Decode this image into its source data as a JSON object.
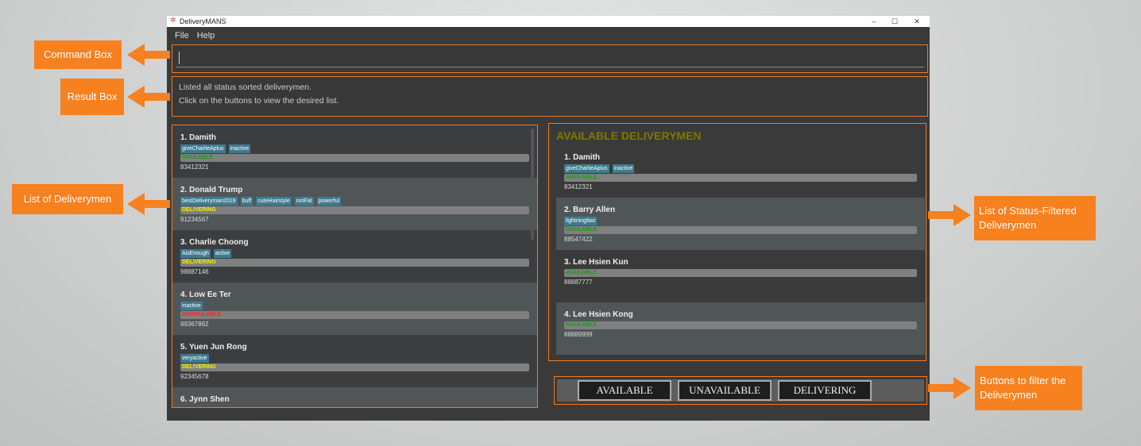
{
  "window": {
    "title": "DeliveryMANS",
    "controls": [
      "–",
      "☐",
      "✕"
    ]
  },
  "menu": [
    "File",
    "Help"
  ],
  "command_box": {
    "value": ""
  },
  "result_box": {
    "lines": [
      "Listed all status sorted deliverymen.",
      "Click on the buttons to view the desired list."
    ]
  },
  "status_colors": {
    "AVAILABLE": "#1a9a1a",
    "DELIVERING": "#f2f200",
    "UNAVAILABLE": "#ff2020"
  },
  "deliverymen": [
    {
      "label": "1.  Damith",
      "tags": [
        "giveCharlieAplus",
        "inactive"
      ],
      "status": "AVAILABLE",
      "phone": "83412321"
    },
    {
      "label": "2.  Donald Trump",
      "tags": [
        "bestDeliveryman2019",
        "buff",
        "cuteHairstyle",
        "notFat",
        "powerful"
      ],
      "status": "DELIVERING",
      "phone": "91234567"
    },
    {
      "label": "3.  Charlie Choong",
      "tags": [
        "AisEnough",
        "active"
      ],
      "status": "DELIVERING",
      "phone": "98887146"
    },
    {
      "label": "4.  Low Ee Ter",
      "tags": [
        "inactive"
      ],
      "status": "UNAVAILABLE",
      "phone": "99367862"
    },
    {
      "label": "5.  Yuen Jun Rong",
      "tags": [
        "veryactive"
      ],
      "status": "DELIVERING",
      "phone": "92345678"
    },
    {
      "label": "6.  Jynn Shen",
      "tags": [],
      "status": "",
      "phone": ""
    }
  ],
  "filtered": {
    "title": "AVAILABLE DELIVERYMEN",
    "items": [
      {
        "label": "1.  Damith",
        "tags": [
          "giveCharlieAplus",
          "inactive"
        ],
        "status": "AVAILABLE",
        "phone": "83412321"
      },
      {
        "label": "2.  Barry Allen",
        "tags": [
          "lightningfast"
        ],
        "status": "AVAILABLE",
        "phone": "88547422"
      },
      {
        "label": "3.  Lee Hsien Kun",
        "tags": [],
        "status": "AVAILABLE",
        "phone": "88887777"
      },
      {
        "label": "4.  Lee Hsien Kong",
        "tags": [],
        "status": "AVAILABLE",
        "phone": "88889999"
      }
    ]
  },
  "filter_buttons": [
    "AVAILABLE",
    "UNAVAILABLE",
    "DELIVERING"
  ],
  "annotations": {
    "command_box": "Command Box",
    "result_box": "Result Box",
    "list": "List of Deliverymen",
    "filtered_list": "List of Status-Filtered Deliverymen",
    "buttons": "Buttons to filter the Deliverymen"
  },
  "accent": "#f7801f"
}
